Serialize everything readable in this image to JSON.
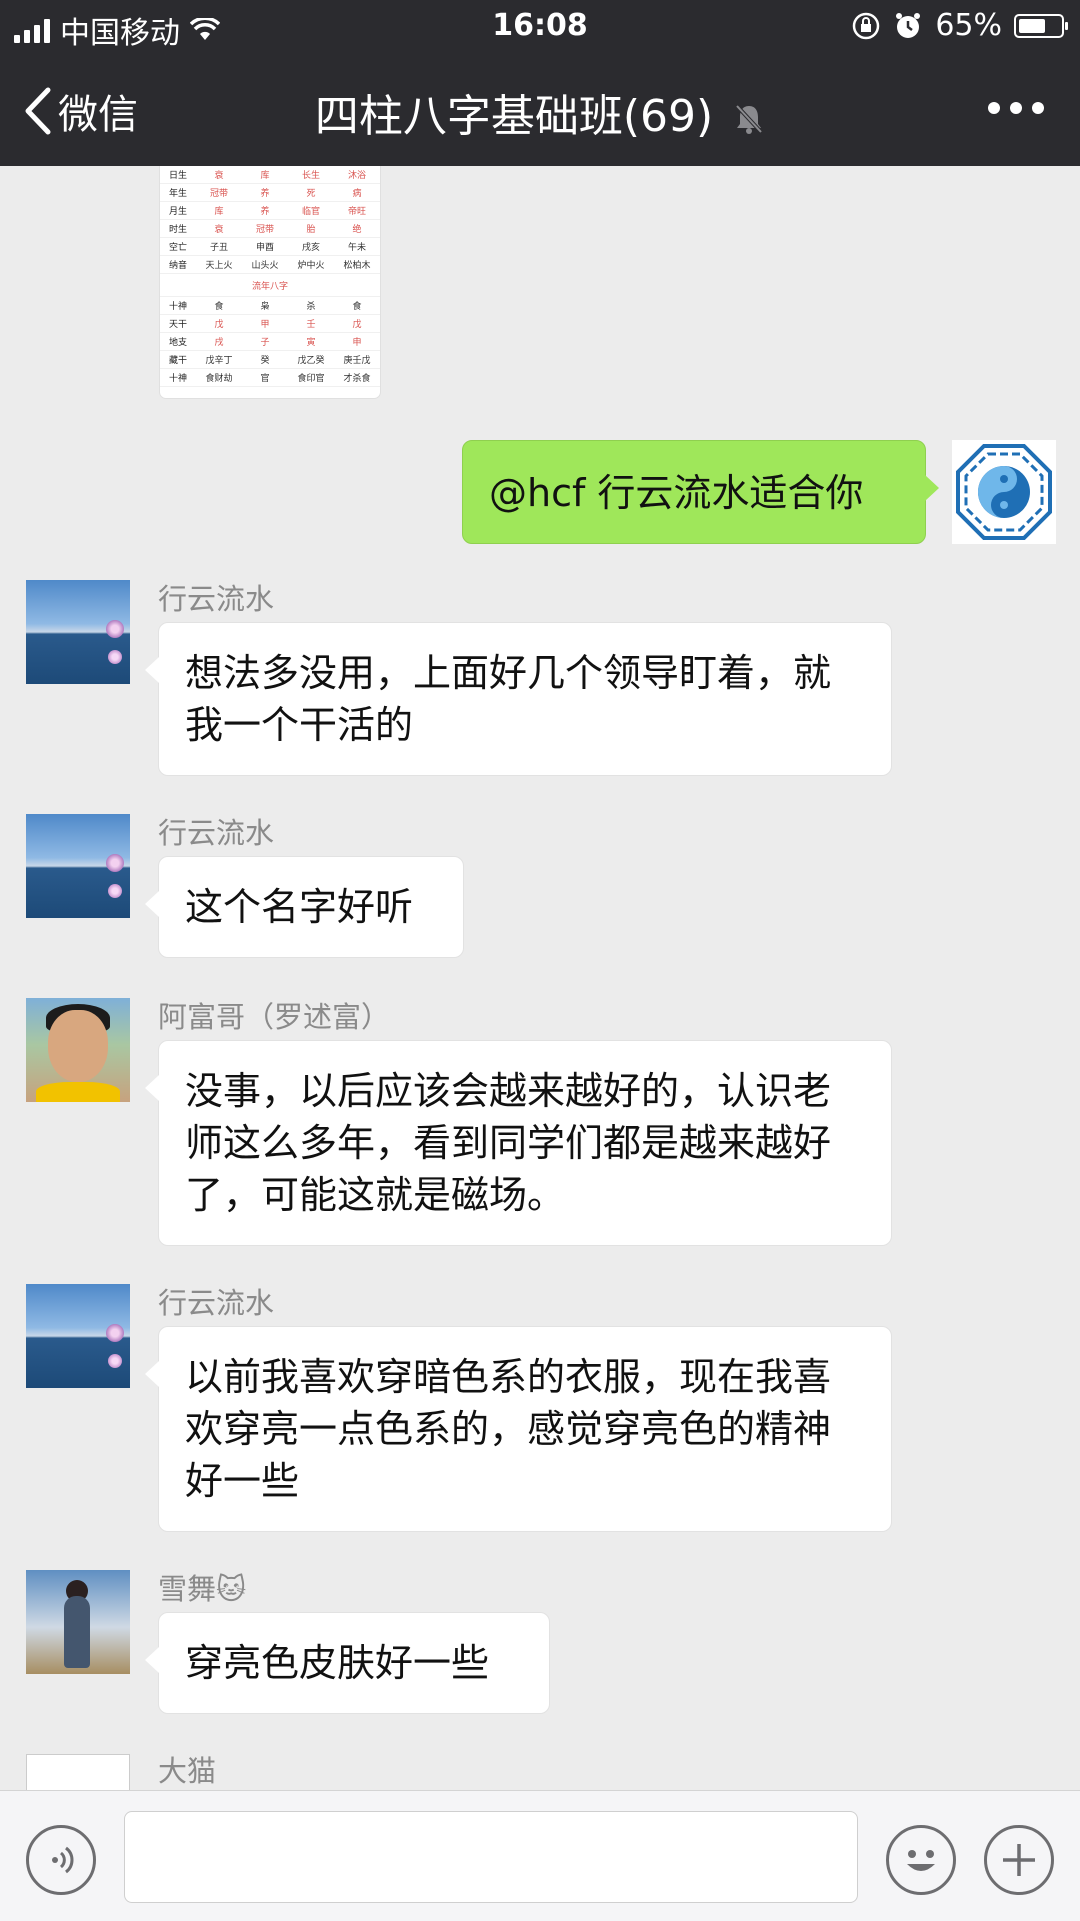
{
  "status_bar": {
    "carrier": "中国移动",
    "time": "16:08",
    "battery": "65%",
    "battery_level": 0.65
  },
  "nav": {
    "back_label": "微信",
    "title": "四柱八字基础班(69)",
    "more_icon": "more-dots-icon"
  },
  "shared_image": {
    "rows_top": [
      [
        "日生",
        "衰",
        "库",
        "长生",
        "沐浴"
      ],
      [
        "年生",
        "冠带",
        "养",
        "死",
        "病"
      ],
      [
        "月生",
        "库",
        "养",
        "临官",
        "帝旺"
      ],
      [
        "时生",
        "衰",
        "冠带",
        "胎",
        "绝"
      ],
      [
        "空亡",
        "子丑",
        "申酉",
        "戌亥",
        "午未"
      ],
      [
        "纳音",
        "天上火",
        "山头火",
        "炉中火",
        "松柏木"
      ]
    ],
    "divider": "流年八字",
    "rows_bottom": [
      [
        "十神",
        "食",
        "枭",
        "杀",
        "食"
      ],
      [
        "天干",
        "戊",
        "甲",
        "壬",
        "戊"
      ],
      [
        "地支",
        "戌",
        "子",
        "寅",
        "申"
      ],
      [
        "藏干",
        "戊辛丁",
        "癸",
        "戊乙癸",
        "庚壬戊"
      ],
      [
        "十神",
        "食财劫",
        "官",
        "食印官",
        "才杀食"
      ]
    ]
  },
  "messages": [
    {
      "sender": "",
      "text": "@hcf 行云流水适合你",
      "mine": true
    },
    {
      "sender": "行云流水",
      "text": "想法多没用，上面好几个领导盯着，就我一个干活的"
    },
    {
      "sender": "行云流水",
      "text": "这个名字好听"
    },
    {
      "sender": "阿富哥（罗述富）",
      "text": "没事，以后应该会越来越好的，认识老师这么多年，看到同学们都是越来越好了，可能这就是磁场。"
    },
    {
      "sender": "行云流水",
      "text": "以前我喜欢穿暗色系的衣服，现在我喜欢穿亮一点色系的，感觉穿亮色的精神好一些"
    },
    {
      "sender": "雪舞🐱",
      "text": "穿亮色皮肤好一些"
    },
    {
      "sender": "大猫",
      "text": ""
    }
  ],
  "colors": {
    "nav_bg": "#2b2b2f",
    "chat_bg": "#ececec",
    "my_bubble": "#9fe75a",
    "their_bubble": "#ffffff"
  },
  "input_bar": {
    "voice_icon": "voice-icon",
    "emoji_icon": "emoji-icon",
    "plus_icon": "plus-icon"
  }
}
